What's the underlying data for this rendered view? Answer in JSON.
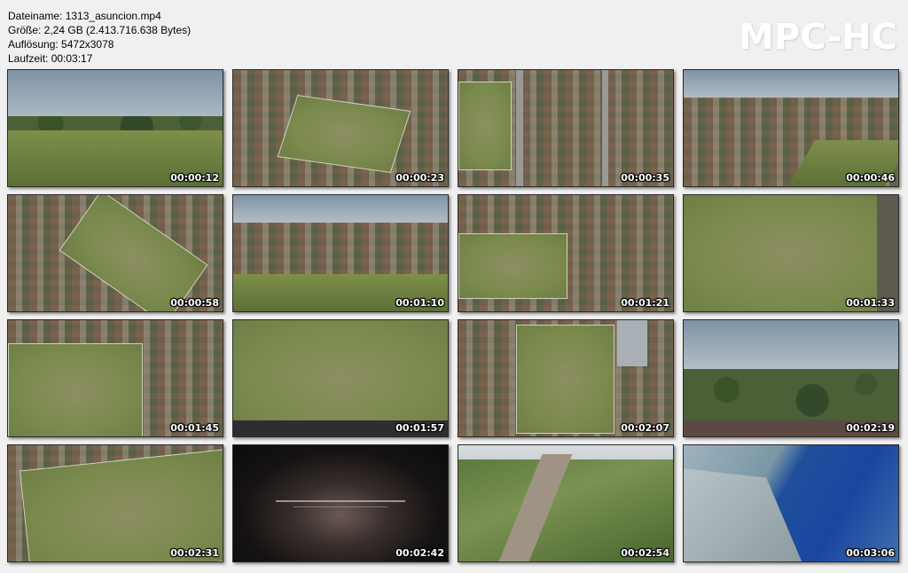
{
  "info": {
    "filename": "Dateiname: 1313_asuncion.mp4",
    "size": "Größe: 2,24 GB (2.413.716.638 Bytes)",
    "resolution": "Auflösung: 5472x3078",
    "duration": "Laufzeit: 00:03:17"
  },
  "logo": "MPC-HC",
  "thumbnails": [
    {
      "time": "00:00:12",
      "scene": "ground-field"
    },
    {
      "time": "00:00:23",
      "scene": "aerial-field-city"
    },
    {
      "time": "00:00:35",
      "scene": "aerial-topdown-city"
    },
    {
      "time": "00:00:46",
      "scene": "aerial-stadium-sky"
    },
    {
      "time": "00:00:58",
      "scene": "aerial-field-diagonal"
    },
    {
      "time": "00:01:10",
      "scene": "aerial-skyline"
    },
    {
      "time": "00:01:21",
      "scene": "aerial-field-town"
    },
    {
      "time": "00:01:33",
      "scene": "aerial-field-close"
    },
    {
      "time": "00:01:45",
      "scene": "aerial-field-side"
    },
    {
      "time": "00:01:57",
      "scene": "aerial-field-goals"
    },
    {
      "time": "00:02:07",
      "scene": "aerial-field-vertical"
    },
    {
      "time": "00:02:19",
      "scene": "aerial-lights-sky"
    },
    {
      "time": "00:02:31",
      "scene": "aerial-field-corner"
    },
    {
      "time": "00:02:42",
      "scene": "smoke-title"
    },
    {
      "time": "00:02:54",
      "scene": "great-wall"
    },
    {
      "time": "00:03:06",
      "scene": "river-cliff"
    }
  ]
}
